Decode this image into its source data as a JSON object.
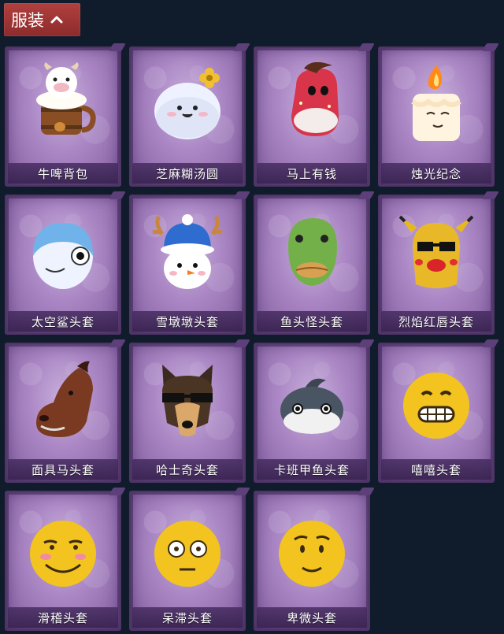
{
  "header": {
    "tab_label": "服装",
    "chevron_icon": "chevron-up-icon"
  },
  "items": [
    {
      "label": "牛啤背包",
      "icon": "cow-beer-mug-icon"
    },
    {
      "label": "芝麻糊汤圆",
      "icon": "rice-ball-flower-icon"
    },
    {
      "label": "马上有钱",
      "icon": "horse-head-icon"
    },
    {
      "label": "烛光纪念",
      "icon": "candle-icon"
    },
    {
      "label": "太空鲨头套",
      "icon": "shark-head-icon"
    },
    {
      "label": "雪墩墩头套",
      "icon": "snowman-antlers-icon"
    },
    {
      "label": "鱼头怪头套",
      "icon": "fish-monster-head-icon"
    },
    {
      "label": "烈焰红唇头套",
      "icon": "yellow-mask-sunglasses-icon"
    },
    {
      "label": "面具马头套",
      "icon": "horse-mask-icon"
    },
    {
      "label": "哈士奇头套",
      "icon": "husky-sunglasses-icon"
    },
    {
      "label": "卡班甲鱼头套",
      "icon": "round-fish-head-icon"
    },
    {
      "label": "嘻嘻头套",
      "icon": "grinning-emoji-icon"
    },
    {
      "label": "滑稽头套",
      "icon": "funny-emoji-icon"
    },
    {
      "label": "呆滞头套",
      "icon": "dazed-emoji-icon"
    },
    {
      "label": "卑微头套",
      "icon": "humble-emoji-icon"
    }
  ],
  "colors": {
    "background": "#101c2b",
    "tab": "#9e3535",
    "card": "#a985c3"
  }
}
